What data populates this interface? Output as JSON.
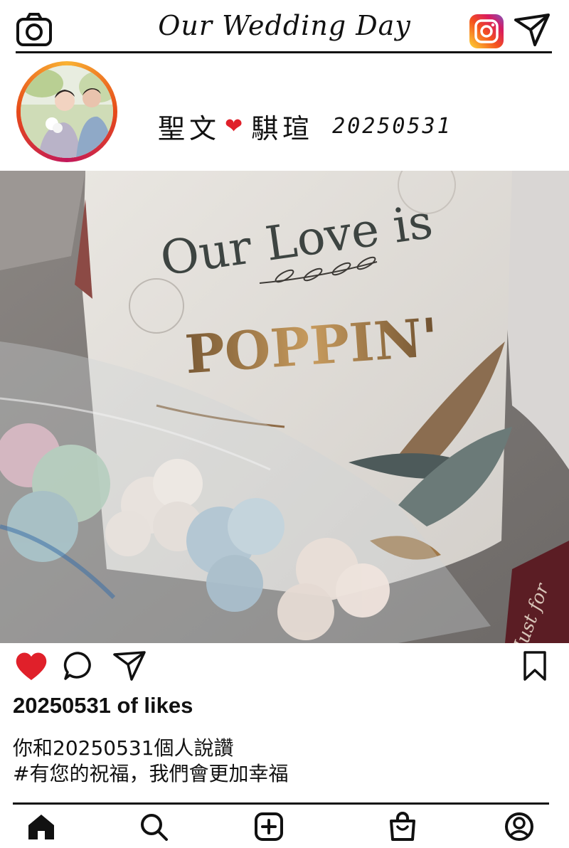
{
  "header": {
    "title": "Our Wedding Day",
    "icons": [
      "camera-icon",
      "instagram-icon",
      "send-icon"
    ]
  },
  "profile": {
    "name_left": "聖文",
    "name_right": "騏瑄",
    "date": "20250531",
    "heart_color": "#e0202a"
  },
  "post": {
    "box_text_line1": "Our Love is",
    "box_text_line2": "POPPIN'",
    "ribbon_text": "Just for",
    "likes_text": "20250531 of likes",
    "caption_line1": "你和20250531個人說讚",
    "caption_line2": "#有您的祝福，我們會更加幸福"
  },
  "actions": {
    "icons": [
      "heart-icon",
      "comment-icon",
      "share-icon",
      "bookmark-icon"
    ],
    "heart_color": "#e0202a"
  },
  "bottom_nav": {
    "icons": [
      "home-icon",
      "search-icon",
      "add-post-icon",
      "shop-icon",
      "profile-icon"
    ]
  }
}
